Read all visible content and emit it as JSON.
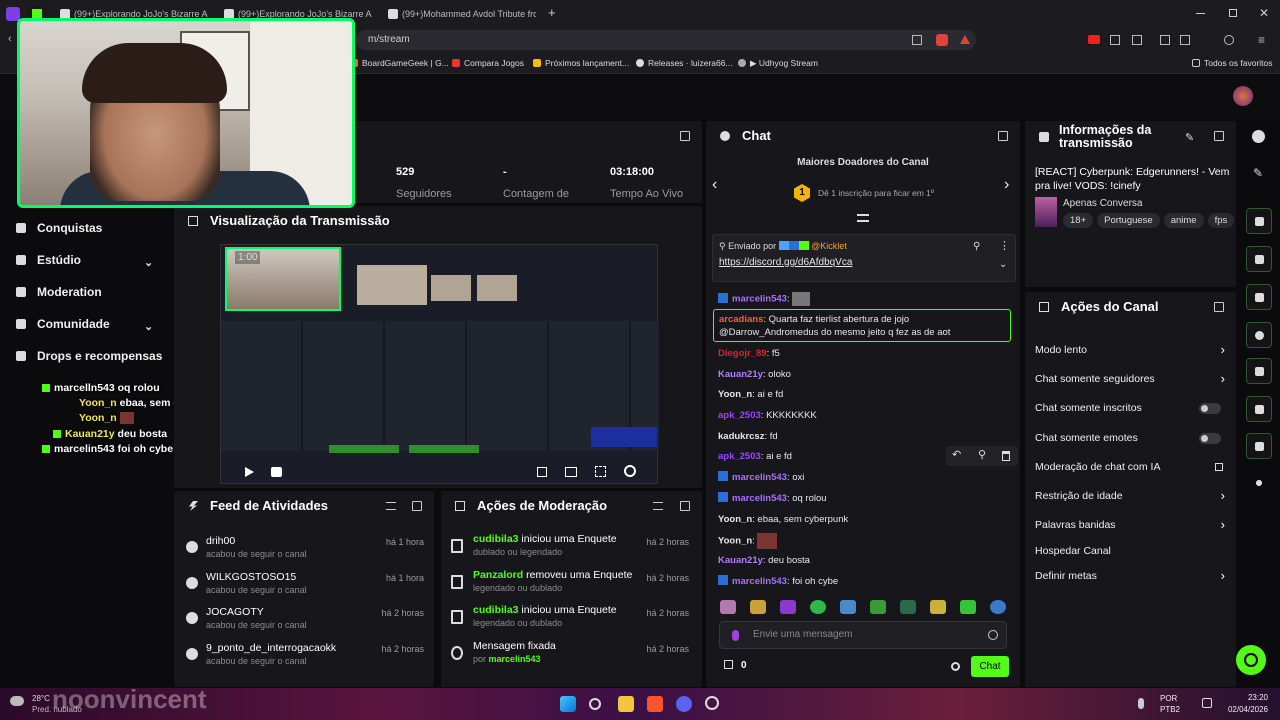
{
  "browser": {
    "tabs": [
      {
        "label": "(99+)Explorando JoJo's Bizarre Adve"
      },
      {
        "label": "(99+)Explorando JoJo's Bizarre Adve"
      },
      {
        "label": "(99+)Mohammed Avdol Tribute from"
      }
    ],
    "new_tab": "+",
    "url": "m/stream",
    "bookmarks": [
      "BoardGameGeek | G...",
      "Compara Jogos",
      "Próximos lançament...",
      "Releases · luizera66...",
      "▶ Udhyog Stream"
    ],
    "favorites": "Todos os favoritos"
  },
  "sidebar": {
    "items": [
      {
        "label": "Conquistas",
        "chevron": ""
      },
      {
        "label": "Estúdio",
        "chevron": "⌄"
      },
      {
        "label": "Moderation",
        "chevron": ""
      },
      {
        "label": "Comunidade",
        "chevron": "⌄"
      },
      {
        "label": "Drops e recompensas",
        "chevron": ""
      }
    ]
  },
  "chat_overlay": [
    {
      "user": "marcelln543",
      "msg": "oq rolou"
    },
    {
      "user": "Yoon_n",
      "msg": "ebaa, sem cyberpunk"
    },
    {
      "user": "Yoon_n",
      "msg": ""
    },
    {
      "user": "Kauan21y",
      "msg": "deu bosta"
    },
    {
      "user": "marcelin543",
      "msg": "foi oh cybe"
    }
  ],
  "stats": [
    {
      "value": "529",
      "label": "Seguidores"
    },
    {
      "value": "-",
      "label": "Contagem de"
    },
    {
      "value": "03:18:00",
      "label": "Tempo Ao Vivo"
    }
  ],
  "preview": {
    "title": "Visualização da Transmissão",
    "timestamp": "1:00"
  },
  "feed": {
    "title": "Feed de Atividades",
    "rows": [
      {
        "name": "drih00",
        "sub": "acabou de seguir o canal",
        "time": "há 1 hora"
      },
      {
        "name": "WILKGOSTOSO15",
        "sub": "acabou de seguir o canal",
        "time": "há 1 hora"
      },
      {
        "name": "JOCAGOTY",
        "sub": "acabou de seguir o canal",
        "time": "há 2 horas"
      },
      {
        "name": "9_ponto_de_interrogacaokk",
        "sub": "acabou de seguir o canal",
        "time": "há 2 horas"
      }
    ]
  },
  "moderation": {
    "title": "Ações de Moderação",
    "rows": [
      {
        "user": "cudibila3",
        "action": " iniciou uma Enquete",
        "sub": "dublado ou legendado",
        "by": "",
        "time": "há 2 horas"
      },
      {
        "user": "Panzalord",
        "action": " removeu uma Enquete",
        "sub": "legendado ou dublado",
        "by": "",
        "time": "há 2 horas"
      },
      {
        "user": "cudibila3",
        "action": " iniciou uma Enquete",
        "sub": "legendado ou dublado",
        "by": "",
        "time": "há 2 horas"
      },
      {
        "user": "",
        "action": "Mensagem fixada",
        "sub": "por ",
        "by": "marcelin543",
        "time": "há 2 horas"
      }
    ]
  },
  "chat": {
    "title": "Chat",
    "donors_title": "Maiores Doadores do Canal",
    "donor_rank": "1",
    "donor_text": "Dê 1 inscrição para ficar em 1º",
    "pinned_by": "Enviado por",
    "pinned_user": "@Kicklet",
    "pinned_link": "https://discord.gg/d6AfdbqVca",
    "messages": [
      {
        "user": "marcelin543",
        "text": "",
        "color": "#a970ff",
        "badge": true
      },
      {
        "user": "arcadians",
        "text": "Quarta faz tierlist abertura de jojo @Darrow_Andromedus do mesmo jeito q fez as de aot",
        "color": "#ff5a3c",
        "badge": false
      },
      {
        "user": "Diegojr_89",
        "text": "f5",
        "color": "#d9232e",
        "badge": false
      },
      {
        "user": "Kauan21y",
        "text": "oloko",
        "color": "#b57bff",
        "badge": false
      },
      {
        "user": "Yoon_n",
        "text": "ai e fd",
        "color": "#e8e8ea",
        "badge": false
      },
      {
        "user": "apk_2503",
        "text": "KKKKKKKK",
        "color": "#9b45ff",
        "badge": false
      },
      {
        "user": "kadukrcsz",
        "text": "fd",
        "color": "#e8e8ea",
        "badge": false
      },
      {
        "user": "apk_2503",
        "text": "ai e fd",
        "color": "#9b45ff",
        "badge": false
      },
      {
        "user": "marcelin543",
        "text": "oxi",
        "color": "#a970ff",
        "badge": true
      },
      {
        "user": "marcelin543",
        "text": "oq rolou",
        "color": "#a970ff",
        "badge": true
      },
      {
        "user": "Yoon_n",
        "text": "ebaa, sem cyberpunk",
        "color": "#e8e8ea",
        "badge": false
      },
      {
        "user": "Yoon_n",
        "text": "",
        "color": "#e8e8ea",
        "badge": false
      },
      {
        "user": "Kauan21y",
        "text": "deu bosta",
        "color": "#b57bff",
        "badge": false
      },
      {
        "user": "marcelin543",
        "text": "foi oh cybe",
        "color": "#a970ff",
        "badge": true
      }
    ],
    "input_placeholder": "Envie uma mensagem",
    "points": "0",
    "send": "Chat"
  },
  "info": {
    "title": "Informações da transmissão",
    "stream_title": "[REACT] Cyberpunk: Edgerunners! - Vem pra live! VODS: !cinefy",
    "category": "Apenas Conversa",
    "tags": [
      "18+",
      "Portuguese",
      "anime",
      "fps"
    ]
  },
  "channel_actions": {
    "title": "Ações do Canal",
    "items": [
      {
        "label": "Modo lento",
        "control": "chevron"
      },
      {
        "label": "Chat somente seguidores",
        "control": "chevron"
      },
      {
        "label": "Chat somente inscritos",
        "control": "toggle"
      },
      {
        "label": "Chat somente emotes",
        "control": "toggle"
      },
      {
        "label": "Moderação de chat com IA",
        "control": "link"
      },
      {
        "label": "Restrição de idade",
        "control": "chevron"
      },
      {
        "label": "Palavras banidas",
        "control": "chevron"
      },
      {
        "label": "Hospedar Canal",
        "control": "none"
      },
      {
        "label": "Definir metas",
        "control": "chevron"
      }
    ]
  },
  "taskbar": {
    "weather_temp": "28°C",
    "weather_desc": "Pred. nublado",
    "lang": "POR",
    "layout": "PTB2",
    "time": "23:20",
    "date": "02/04/2026",
    "watermark": "noonvincent"
  },
  "colors": {
    "accent": "#53fc18",
    "panel": "#17171b",
    "bg": "#0b0b0d"
  }
}
